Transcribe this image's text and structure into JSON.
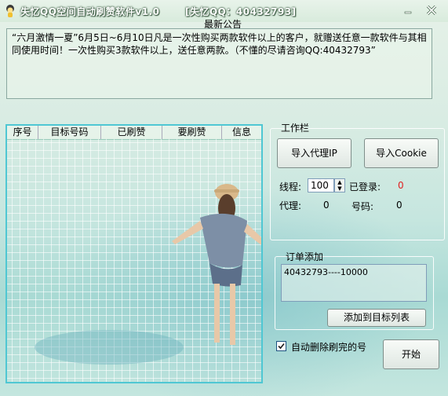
{
  "window": {
    "title": "失忆QQ空间自动刷赞软件v1.0",
    "title_contact": "[失忆QQ：40432793]",
    "minimize_icon": "minimize-icon",
    "close_icon": "close-icon"
  },
  "notice": {
    "title": "最新公告",
    "text": "“六月激情一夏”6月5日~6月10日凡是一次性购买两款软件以上的客户，就赠送任意一款软件与其相同使用时间！一次性购买3款软件以上，送任意两款。（不懂的尽请咨询QQ:40432793”"
  },
  "table": {
    "columns": [
      "序号",
      "目标号码",
      "已刷赞",
      "要刷赞",
      "信息"
    ],
    "rows": []
  },
  "toolbar": {
    "title": "工作栏",
    "import_proxy_label": "导入代理IP",
    "import_cookie_label": "导入Cookie"
  },
  "stats": {
    "threads_label": "线程:",
    "threads_value": "100",
    "logged_in_label": "已登录:",
    "logged_in_value": "0",
    "logged_in_color": "#e02020",
    "proxy_label": "代理:",
    "proxy_value": "0",
    "account_label": "号码:",
    "account_value": "0"
  },
  "order": {
    "title": "订单添加",
    "value": "40432793----10000",
    "add_button_label": "添加到目标列表"
  },
  "options": {
    "auto_delete_label": "自动删除刷完的号",
    "auto_delete_checked": true,
    "start_button_label": "开始"
  }
}
